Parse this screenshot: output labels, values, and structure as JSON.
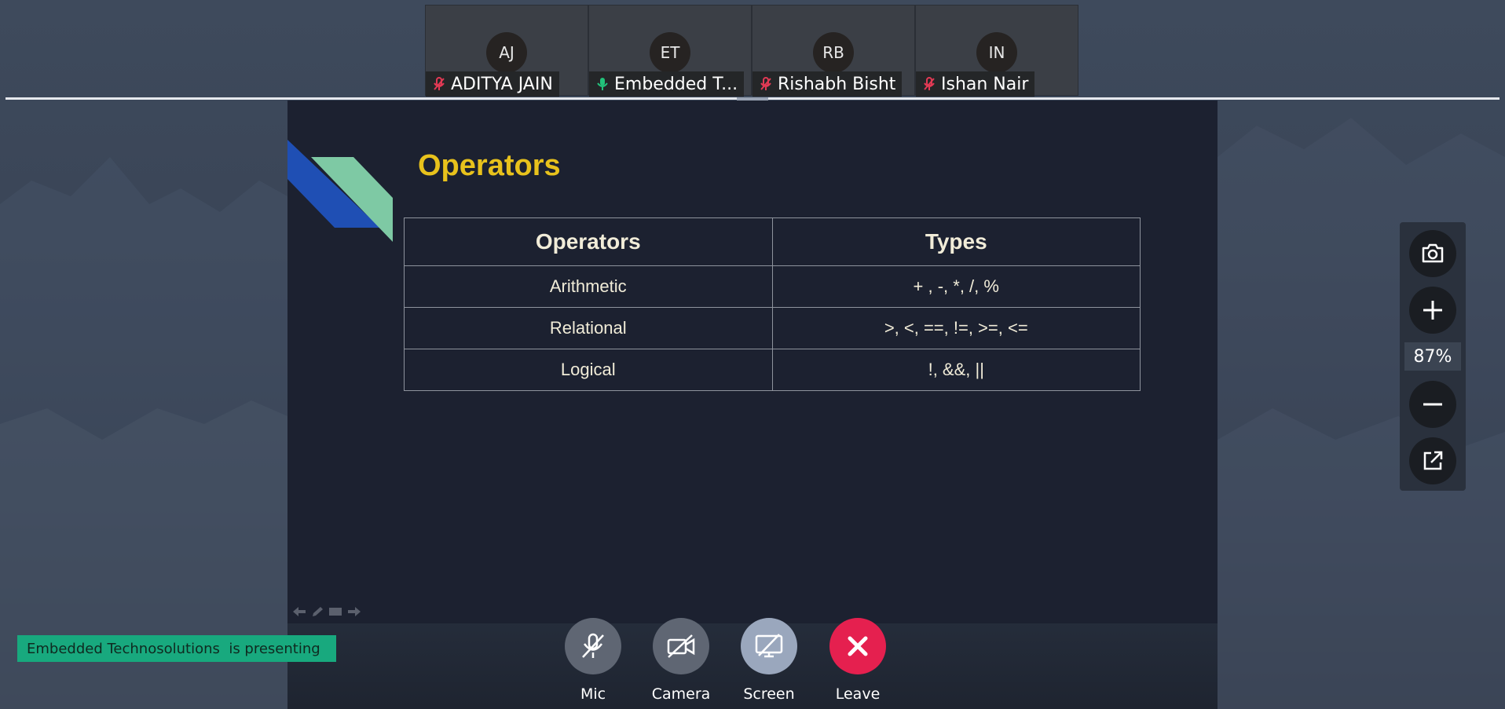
{
  "participants": [
    {
      "initials": "AJ",
      "name": "ADITYA JAIN",
      "mic": "muted"
    },
    {
      "initials": "ET",
      "name": "Embedded T...",
      "mic": "active"
    },
    {
      "initials": "RB",
      "name": "Rishabh Bisht",
      "mic": "muted"
    },
    {
      "initials": "IN",
      "name": "Ishan Nair",
      "mic": "muted"
    }
  ],
  "slide": {
    "title": "Operators",
    "table": {
      "headers": [
        "Operators",
        "Types"
      ],
      "rows": [
        [
          "Arithmetic",
          "+ , -, *, /, %"
        ],
        [
          "Relational",
          ">, <, ==, !=, >=, <="
        ],
        [
          "Logical",
          "!, &&, ||"
        ]
      ]
    }
  },
  "side_panel": {
    "zoom_level": "87%",
    "icons": [
      "camera-icon",
      "plus-icon",
      "minus-icon",
      "open-external-icon"
    ]
  },
  "presenting_banner": "Embedded Technosolutions  is presenting",
  "controls": {
    "mic_label": "Mic",
    "camera_label": "Camera",
    "screen_label": "Screen",
    "leave_label": "Leave"
  },
  "colors": {
    "muted_mic": "#e33a55",
    "active_mic": "#22c27a",
    "slide_title": "#e8c21c",
    "leave_button": "#e5204f",
    "screen_button": "#9aa7bd",
    "banner": "#18a97e"
  }
}
